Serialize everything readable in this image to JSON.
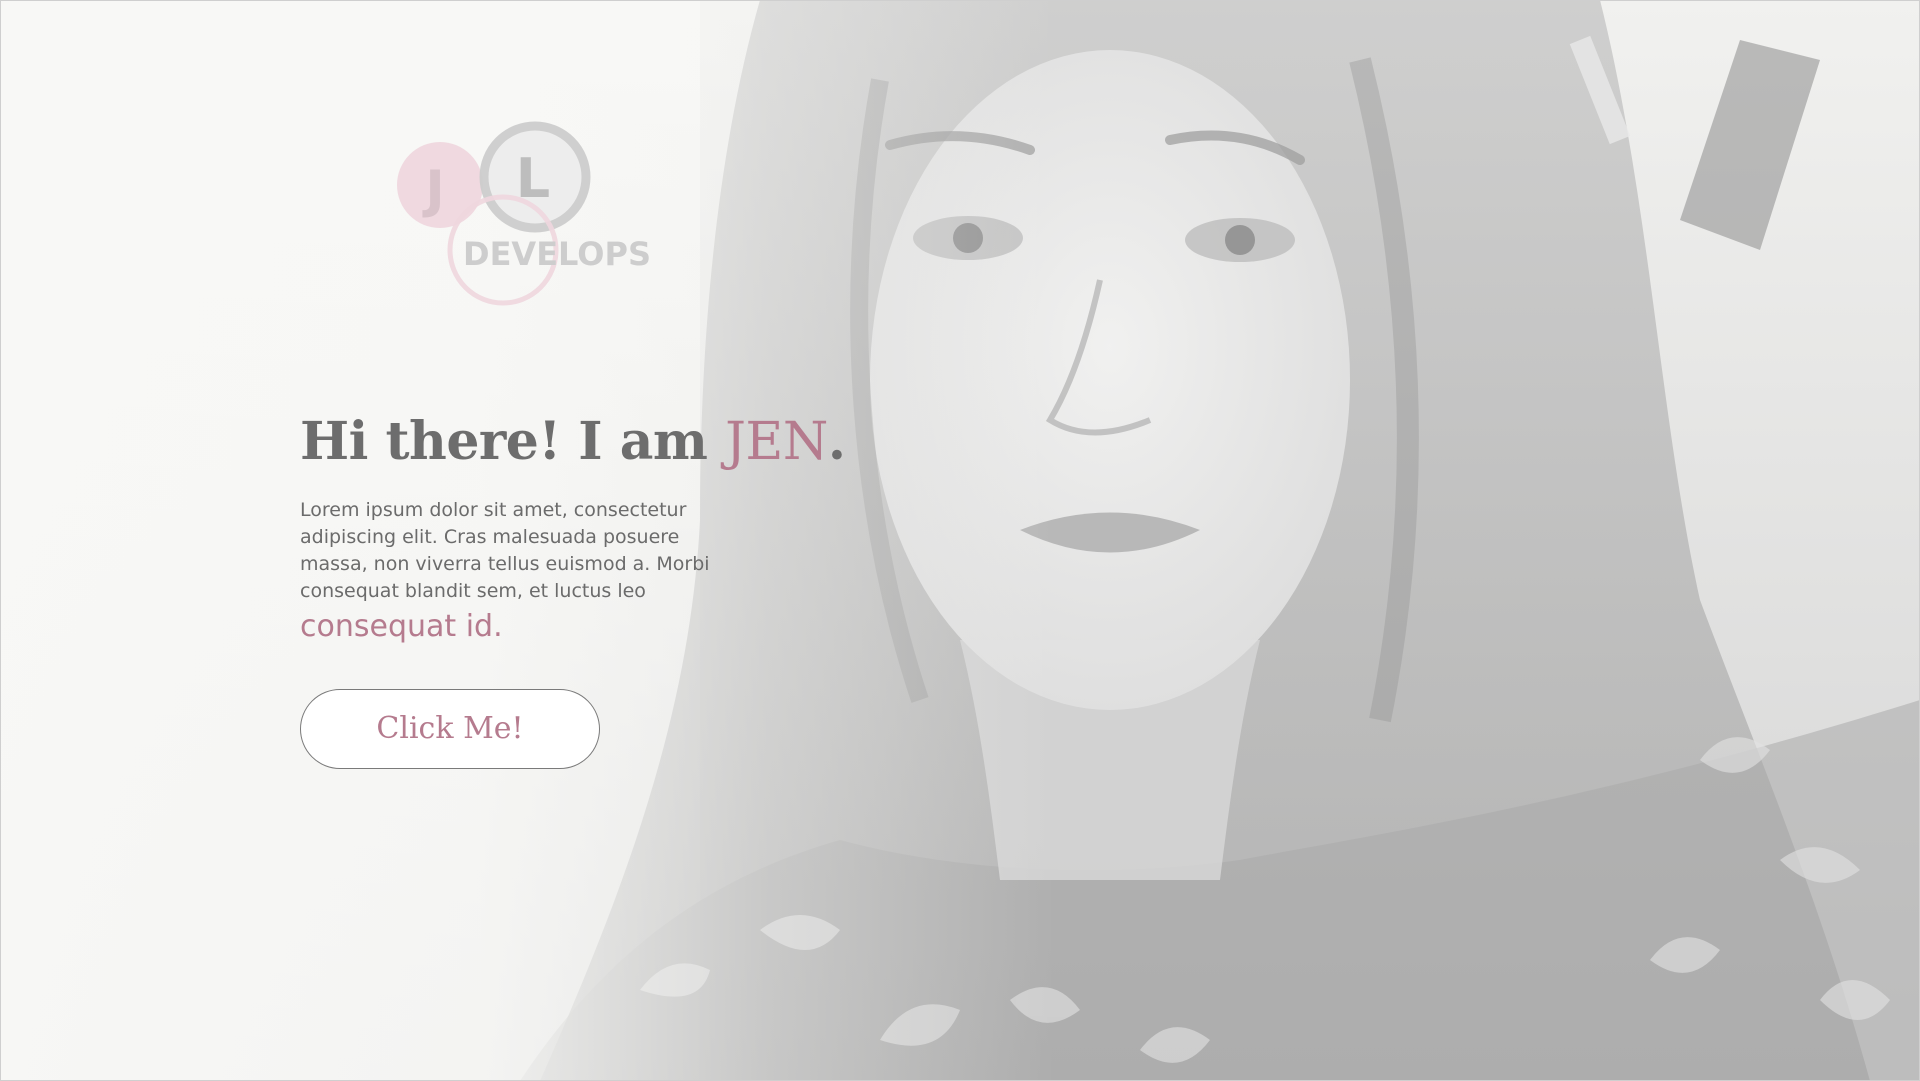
{
  "logo": {
    "letter_left": "J",
    "letter_right": "L",
    "wordmark": "DEVELOPS"
  },
  "hero": {
    "heading_prefix": "Hi there! I am ",
    "heading_name": "JEN",
    "heading_suffix": ".",
    "body_text": "Lorem ipsum dolor sit amet, consectetur adipiscing elit. Cras malesuada posuere massa, non viverra tellus euismod a. Morbi consequat blandit sem, et luctus leo",
    "body_accent": "consequat id",
    "body_accent_suffix": ".",
    "button_label": "Click Me!"
  },
  "colors": {
    "accent": "#b57b8e",
    "text": "#6d6d6d",
    "background": "#f8f8f6"
  }
}
